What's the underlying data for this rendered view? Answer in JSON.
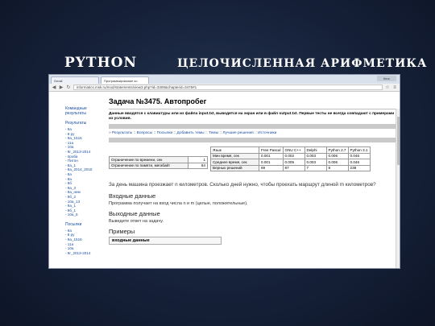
{
  "slide": {
    "title_left": "PYTHON",
    "title_right": "ЦЕЛОЧИСЛЕННАЯ АРИФМЕТИКА"
  },
  "browser": {
    "tabs": [
      "Gmail",
      "Программирование ко"
    ],
    "window_button": "Ilnur",
    "url": "informatics.msk.ru/mod/statements/view3.php?id=3309&chapterid=3475#1"
  },
  "sidebar": {
    "section1": "Командные результаты",
    "section2": "Результаты",
    "items2": [
      "- 9a",
      "- 8 ру",
      "- 9a_1516",
      "- 11a",
      "- 10a",
      "- 9r_2013-2014",
      "- проба",
      "- Питон",
      "- 8a_1",
      "- 8a_2014_2015",
      "- 8a",
      "- 8a",
      "- 8б",
      "- 9a_3",
      "- 9a_нем",
      "- 9б_2",
      "- 10a_13",
      "- 9a_1",
      "- 9б_1",
      "- 10a_5"
    ],
    "section3": "Посылки",
    "items3": [
      "- 9a",
      "- 8 ру",
      "- 9a_1516",
      "- 11a",
      "- 10a",
      "- 9r_2013-2014"
    ]
  },
  "main": {
    "title": "Задача №3475. Автопробег",
    "description": "Данные вводятся с клавиатуры или из файла input.txt, выводятся на экран или в файл output.txt. Первые тесты не всегда совпадают с примерами из условия.",
    "links": [
      "Результаты",
      "Вопросы",
      "Посылки",
      "Добавить темы",
      "Темы",
      "Лучшие решения",
      "Источники"
    ],
    "limits": [
      {
        "label": "Ограничение по времени, сек",
        "value": "1"
      },
      {
        "label": "Ограничение по памяти, мегабайт",
        "value": "64"
      }
    ],
    "stats": {
      "headers": [
        "Язык",
        "Free Pascal",
        "GNU C++",
        "Delphi",
        "Python 2.7",
        "Python 3.1"
      ],
      "rows": [
        [
          "Мин время, сек",
          "0.001",
          "0.002",
          "0.003",
          "0.006",
          "0.046"
        ],
        [
          "Среднее время, сек",
          "0.001",
          "0.005",
          "0.003",
          "0.006",
          "0.046"
        ],
        [
          "Верных решений",
          "69",
          "87",
          "7",
          "8",
          "238"
        ]
      ]
    },
    "statement": "За день машина проезжает n километров. Сколько дней нужно, чтобы проехать маршрут длиной m километров?",
    "input_header": "Входные данные",
    "input_text": "Программа получает на вход числа n и m (целые, положительные).",
    "output_header": "Выходные данные",
    "output_text": "Выведите ответ на задачу.",
    "examples_header": "Примеры",
    "examples_box": "входные данные"
  }
}
